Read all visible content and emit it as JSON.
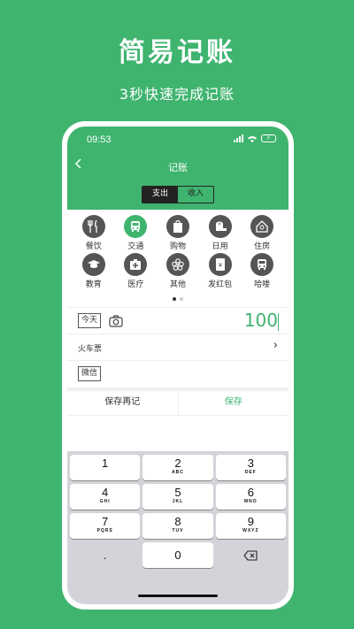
{
  "promo": {
    "title": "简易记账",
    "subtitle": "3秒快速完成记账"
  },
  "status": {
    "time": "09:53"
  },
  "nav": {
    "back_icon": "back-arrow-icon",
    "title": "记账"
  },
  "segment": {
    "expense_label": "支出",
    "income_label": "收入",
    "selected": "支出"
  },
  "categories": [
    {
      "label": "餐饮",
      "icon": "fork-knife-icon"
    },
    {
      "label": "交通",
      "icon": "bus-icon"
    },
    {
      "label": "购物",
      "icon": "shopping-bag-icon"
    },
    {
      "label": "日用",
      "icon": "toilet-paper-icon"
    },
    {
      "label": "住房",
      "icon": "house-icon"
    },
    {
      "label": "教育",
      "icon": "graduation-cap-icon"
    },
    {
      "label": "医疗",
      "icon": "first-aid-icon"
    },
    {
      "label": "其他",
      "icon": "flower-icon"
    },
    {
      "label": "发红包",
      "icon": "red-envelope-icon"
    },
    {
      "label": "哈喽",
      "icon": "bus-icon"
    }
  ],
  "selected_category": "交通",
  "pager": {
    "pages": 2,
    "current": 1
  },
  "entry": {
    "date_label": "今天",
    "amount": "100",
    "note": "火车票",
    "account": "微信"
  },
  "actions": {
    "save_again": "保存再记",
    "save": "保存"
  },
  "keypad": {
    "rows": [
      [
        {
          "n": "1",
          "l": ""
        },
        {
          "n": "2",
          "l": "ABC"
        },
        {
          "n": "3",
          "l": "DEF"
        }
      ],
      [
        {
          "n": "4",
          "l": "GHI"
        },
        {
          "n": "5",
          "l": "JKL"
        },
        {
          "n": "6",
          "l": "MNO"
        }
      ],
      [
        {
          "n": "7",
          "l": "PQRS"
        },
        {
          "n": "8",
          "l": "TUV"
        },
        {
          "n": "9",
          "l": "WXYZ"
        }
      ]
    ],
    "dot": ".",
    "zero": "0",
    "delete_icon": "backspace-icon"
  },
  "colors": {
    "accent": "#3FB46F",
    "icon_bg": "#555555",
    "keypad_bg": "#D2D4D9"
  }
}
